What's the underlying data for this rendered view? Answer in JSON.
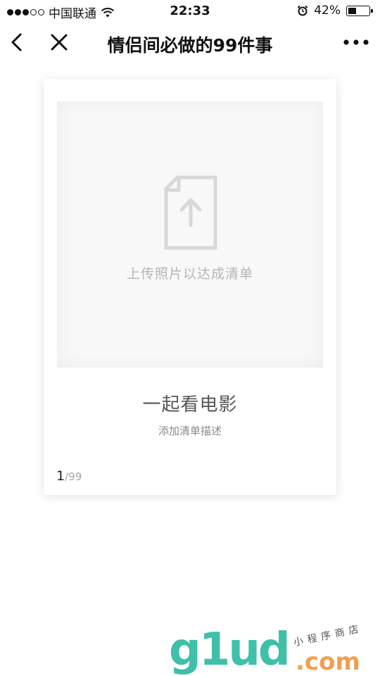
{
  "status_bar": {
    "carrier": "中国联通",
    "time": "22:33",
    "battery": "42%",
    "battery_level": 0.42,
    "signal": {
      "filled": 3,
      "total": 5
    }
  },
  "nav": {
    "title": "情侣间必做的99件事"
  },
  "card": {
    "upload_text": "上传照片以达成清单",
    "item_title": "一起看电影",
    "description_placeholder": "添加清单描述",
    "current": "1",
    "total": "/99"
  },
  "watermark": {
    "brand": "g1ud",
    "suffix": ".com",
    "tagline": "小程序商店"
  },
  "colors": {
    "watermark_teal": "#3fc0a8",
    "watermark_orange": "#f0a050"
  }
}
